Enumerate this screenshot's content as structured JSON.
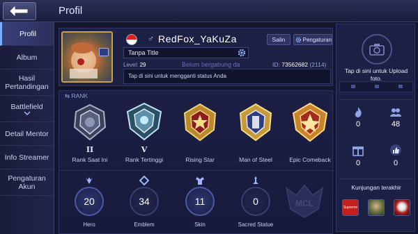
{
  "header": {
    "title": "Profil"
  },
  "sidebar": {
    "items": [
      {
        "label": "Profil",
        "active": true
      },
      {
        "label": "Album"
      },
      {
        "label": "Hasil Pertandingan"
      },
      {
        "label": "Battlefield"
      },
      {
        "label": "Detail Mentor"
      },
      {
        "label": "Info Streamer"
      },
      {
        "label": "Pengaturan Akun"
      }
    ]
  },
  "profile": {
    "username": "RedFox_YaKuZa",
    "copy_label": "Salin",
    "settings_label": "Pengaturan",
    "title_value": "Tanpa Title",
    "level_label": "Level:",
    "level": "29",
    "guild_status": "Belum bergabung da",
    "id_label": "ID:",
    "id": "73562682",
    "server": "(2114)",
    "status_placeholder": "Tap di sini untuk mengganti status Anda"
  },
  "rank": {
    "header": "RANK",
    "badges": [
      {
        "label": "Rank Saat Ini",
        "tier": "II"
      },
      {
        "label": "Rank Tertinggi",
        "tier": "V"
      },
      {
        "label": "Rising Star"
      },
      {
        "label": "Man of Steel"
      },
      {
        "label": "Epic Comeback"
      }
    ]
  },
  "stats": [
    {
      "label": "Hero",
      "value": "20"
    },
    {
      "label": "Emblem",
      "value": "34"
    },
    {
      "label": "Skin",
      "value": "11"
    },
    {
      "label": "Sacred Statue",
      "value": "0"
    }
  ],
  "watermark": "MCL",
  "right_panel": {
    "upload_text": "Tap di sini untuk Upload foto.",
    "counters": [
      {
        "icon": "fire-icon",
        "value": "0"
      },
      {
        "icon": "friends-icon",
        "value": "48"
      },
      {
        "icon": "gift-icon",
        "value": "0"
      },
      {
        "icon": "thumbs-up-icon",
        "value": "0"
      }
    ],
    "recent_visits_label": "Kunjungan terakhir",
    "visitor_1_text": "Supreme"
  },
  "colors": {
    "accent": "#7fb0ff",
    "gold": "#c9a34a",
    "panel": "#1d2045",
    "background": "#14162e"
  }
}
